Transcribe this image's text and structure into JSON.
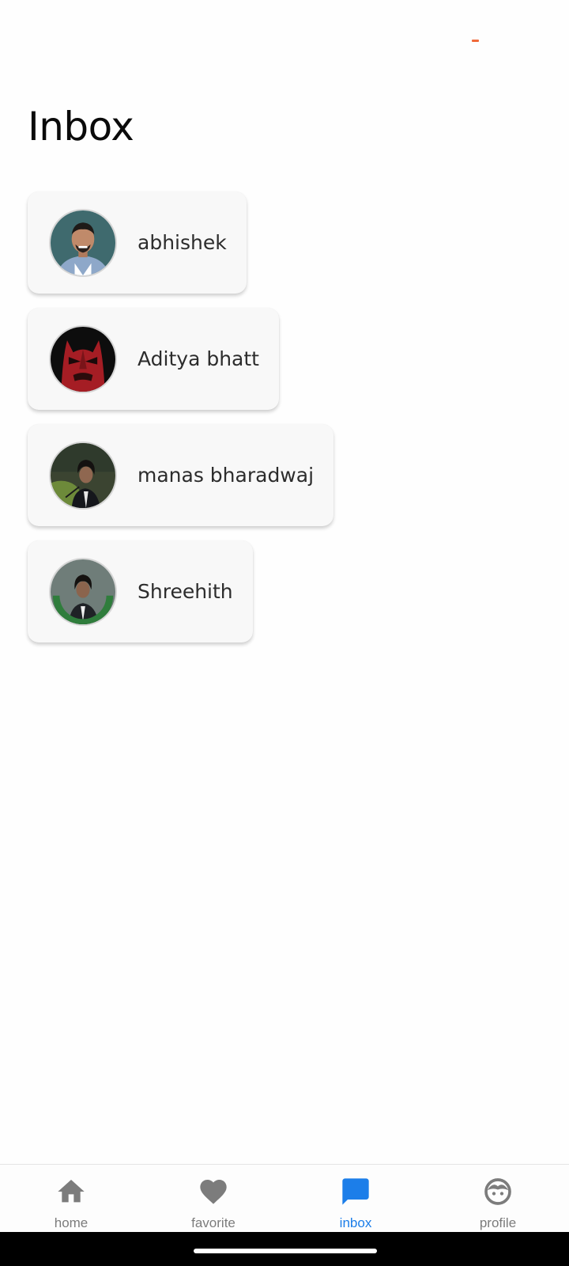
{
  "header": {
    "title": "Inbox"
  },
  "conversations": [
    {
      "name": "abhishek"
    },
    {
      "name": "Aditya bhatt"
    },
    {
      "name": "manas bharadwaj"
    },
    {
      "name": "Shreehith"
    }
  ],
  "nav": {
    "active": "inbox",
    "active_color": "#1c7ee9",
    "inactive_color": "#7c7c7c",
    "items": [
      {
        "label": "home",
        "icon": "home-icon"
      },
      {
        "label": "favorite",
        "icon": "heart-icon"
      },
      {
        "label": "inbox",
        "icon": "chat-icon"
      },
      {
        "label": "profile",
        "icon": "face-icon"
      }
    ]
  },
  "colors": {
    "status_indicator": "#f06a3a",
    "card_background": "#f8f8f8"
  }
}
